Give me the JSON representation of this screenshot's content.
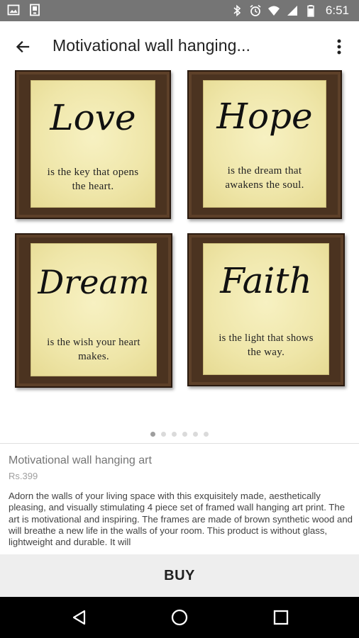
{
  "status_bar": {
    "time": "6:51",
    "left_icons": [
      "image-icon",
      "tablet-icon"
    ],
    "right_icons": [
      "bluetooth-icon",
      "alarm-icon",
      "wifi-icon",
      "signal-icon",
      "battery-icon"
    ]
  },
  "app_bar": {
    "title": "Motivational wall hanging...",
    "back_icon": "arrow-back-icon",
    "more_icon": "more-vert-icon"
  },
  "gallery": {
    "frames": [
      {
        "word": "Love",
        "line1": "is the key that opens",
        "line2": "the heart."
      },
      {
        "word": "Hope",
        "line1": "is the dream that",
        "line2": "awakens the soul."
      },
      {
        "word": "Dream",
        "line1": "is the wish your heart",
        "line2": "makes."
      },
      {
        "word": "Faith",
        "line1": "is the light that shows",
        "line2": "the way."
      }
    ],
    "pager": {
      "count": 6,
      "active_index": 0
    }
  },
  "product": {
    "name": "Motivational wall hanging art",
    "price": "Rs.399",
    "description": "Adorn the walls of your living space with this exquisitely made, aesthetically pleasing, and visually stimulating 4 piece set of framed wall hanging art print. The art is motivational and inspiring. The frames are made of brown synthetic wood and will breathe a new life in the walls of your room. This product is without glass, lightweight and durable. It will"
  },
  "buy_label": "BUY",
  "nav_bar": {
    "icons": [
      "back-triangle-icon",
      "home-circle-icon",
      "recents-square-icon"
    ]
  },
  "colors": {
    "status_bar": "#757575",
    "frame_wood": "#4b3320",
    "canvas_cream": "#efe6a9",
    "buy_bar": "#eeeeee",
    "nav_bar": "#000000"
  }
}
